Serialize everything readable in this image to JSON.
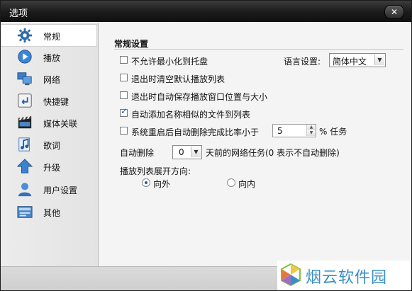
{
  "window": {
    "title": "选项",
    "close_glyph": "✕"
  },
  "sidebar": {
    "items": [
      {
        "label": "常规",
        "icon": "gear-icon",
        "selected": true
      },
      {
        "label": "播放",
        "icon": "play-icon"
      },
      {
        "label": "网络",
        "icon": "network-icon"
      },
      {
        "label": "快捷键",
        "icon": "shortcut-key-icon"
      },
      {
        "label": "媒体关联",
        "icon": "media-association-icon"
      },
      {
        "label": "歌词",
        "icon": "lyrics-icon"
      },
      {
        "label": "升级",
        "icon": "upgrade-icon"
      },
      {
        "label": "用户设置",
        "icon": "user-icon"
      },
      {
        "label": "其他",
        "icon": "other-icon"
      }
    ]
  },
  "general": {
    "section_title": "常规设置",
    "options": [
      {
        "label": "不允许最小化到托盘",
        "checked": false
      },
      {
        "label": "退出时清空默认播放列表",
        "checked": false
      },
      {
        "label": "退出时自动保存播放窗口位置与大小",
        "checked": false
      },
      {
        "label": "自动添加名称相似的文件到列表",
        "checked": true
      },
      {
        "label": "系统重启后自动删除完成比率小于",
        "checked": false
      }
    ],
    "language_label": "语言设置:",
    "language_value": "简体中文",
    "ratio_value": "5",
    "ratio_suffix": "% 任务",
    "auto_delete_label": "自动删除",
    "auto_delete_days": "0",
    "auto_delete_suffix": "天前的网络任务(0 表示不自动删除)",
    "playlist_direction_label": "播放列表展开方向:",
    "direction_options": [
      {
        "label": "向外",
        "selected": true
      },
      {
        "label": "向内",
        "selected": false
      }
    ]
  },
  "watermark": {
    "text": "烟云软件园"
  },
  "colors": {
    "accent": "#1d5fa8",
    "watermark": "#3a8fc7"
  }
}
